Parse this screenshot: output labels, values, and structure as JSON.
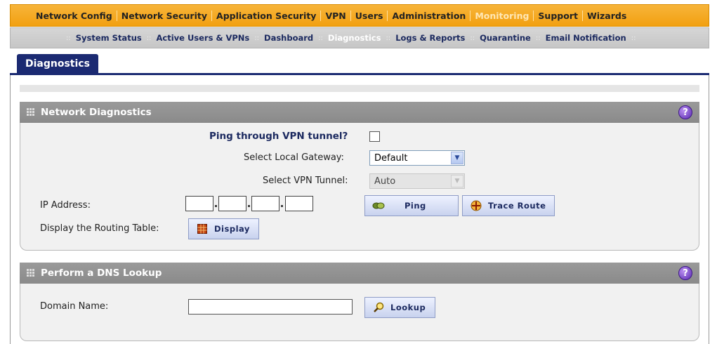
{
  "top_nav": {
    "items": [
      "Network Config",
      "Network Security",
      "Application Security",
      "VPN",
      "Users",
      "Administration",
      "Monitoring",
      "Support",
      "Wizards"
    ],
    "active": "Monitoring"
  },
  "sub_nav": {
    "items": [
      "System Status",
      "Active Users & VPNs",
      "Dashboard",
      "Diagnostics",
      "Logs & Reports",
      "Quarantine",
      "Email Notification"
    ],
    "active": "Diagnostics"
  },
  "tab": {
    "label": "Diagnostics"
  },
  "network_diagnostics": {
    "title": "Network Diagnostics",
    "help_icon": "?",
    "ping_vpn_label": "Ping through VPN tunnel?",
    "ping_vpn_checked": false,
    "local_gateway_label": "Select Local Gateway:",
    "local_gateway_value": "Default",
    "vpn_tunnel_label": "Select VPN Tunnel:",
    "vpn_tunnel_value": "Auto",
    "ip_address_label": "IP Address:",
    "ip_octets": [
      "",
      "",
      "",
      ""
    ],
    "ping_button": "Ping",
    "trace_route_button": "Trace Route",
    "routing_table_label": "Display the Routing Table:",
    "display_button": "Display"
  },
  "dns_lookup": {
    "title": "Perform a DNS Lookup",
    "help_icon": "?",
    "domain_name_label": "Domain Name:",
    "domain_name_value": "",
    "lookup_button": "Lookup"
  },
  "colors": {
    "top_nav_bg": "#f2a010",
    "sub_nav_bg": "#c6c6c6",
    "tab_bg": "#1b2a72",
    "panel_header_bg": "#8a8a8a",
    "panel_body_bg": "#f1f1f1"
  }
}
